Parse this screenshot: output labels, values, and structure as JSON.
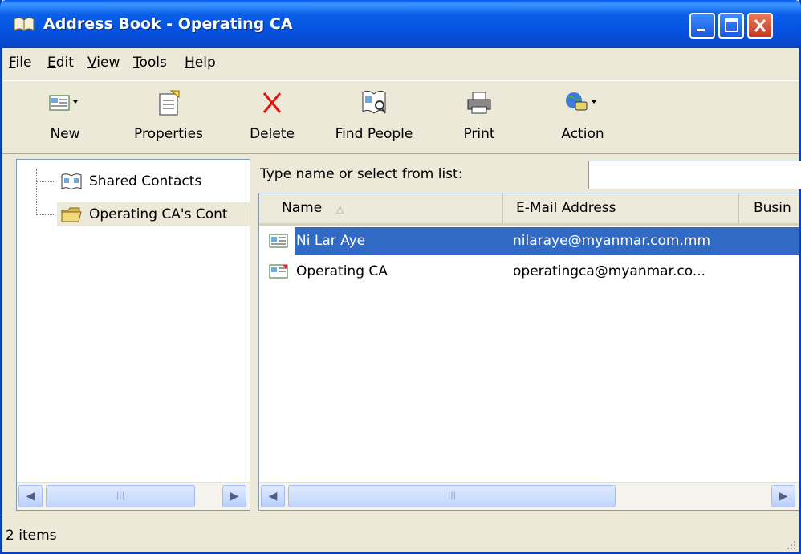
{
  "window": {
    "title": "Address Book - Operating CA"
  },
  "menu": [
    {
      "label": "File",
      "mnemonic": "F",
      "rest": "ile"
    },
    {
      "label": "Edit",
      "mnemonic": "E",
      "rest": "dit"
    },
    {
      "label": "View",
      "mnemonic": "V",
      "rest": "iew"
    },
    {
      "label": "Tools",
      "mnemonic": "T",
      "rest": "ools"
    },
    {
      "label": "Help",
      "mnemonic": "H",
      "rest": "elp"
    }
  ],
  "toolbar": {
    "new": "New",
    "properties": "Properties",
    "delete": "Delete",
    "find_people": "Find People",
    "print": "Print",
    "action": "Action"
  },
  "tree": {
    "items": [
      {
        "label": "Shared Contacts",
        "icon": "shared-contacts-icon"
      },
      {
        "label": "Operating CA's Cont",
        "icon": "folder-icon"
      }
    ]
  },
  "search": {
    "label": "Type name or select from list:",
    "value": ""
  },
  "list": {
    "columns": [
      "Name",
      "E-Mail Address",
      "Busin"
    ],
    "rows": [
      {
        "name": "Ni Lar Aye",
        "email": "nilaraye@myanmar.com.mm",
        "selected": true
      },
      {
        "name": "Operating CA",
        "email": "operatingca@myanmar.co...",
        "selected": false
      }
    ]
  },
  "status": {
    "text": "2 items"
  },
  "colors": {
    "title_bar": "#0553e3",
    "selection": "#316ac5",
    "face": "#ece9d8"
  }
}
